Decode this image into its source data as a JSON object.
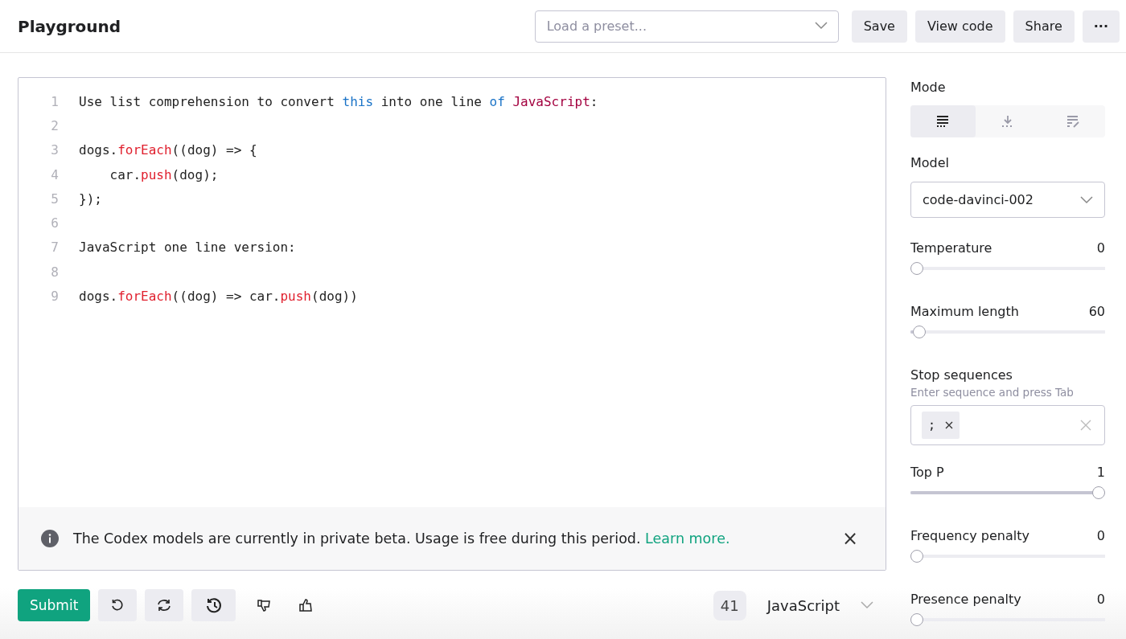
{
  "header": {
    "title": "Playground",
    "preset": {
      "placeholder": "Load a preset..."
    },
    "buttons": [
      "Save",
      "View code",
      "Share"
    ],
    "more": "···"
  },
  "editor": {
    "lines": [
      {
        "number": "1",
        "tokens": [
          {
            "text": "Use list comprehension to convert ",
            "kind": "plain"
          },
          {
            "text": "this",
            "kind": "keyword"
          },
          {
            "text": " into one line ",
            "kind": "plain"
          },
          {
            "text": "of",
            "kind": "keyword"
          },
          {
            "text": " JavaScript",
            "kind": "type"
          },
          {
            "text": ":",
            "kind": "plain"
          }
        ]
      },
      {
        "number": "2"
      },
      {
        "number": "3",
        "tokens": [
          {
            "text": "dogs.",
            "kind": "plain"
          },
          {
            "text": "forEach",
            "kind": "function"
          },
          {
            "text": "((dog) => {",
            "kind": "plain"
          }
        ]
      },
      {
        "number": "4",
        "tokens": [
          {
            "text": "    car.",
            "kind": "plain"
          },
          {
            "text": "push",
            "kind": "function"
          },
          {
            "text": "(dog);",
            "kind": "plain"
          }
        ]
      },
      {
        "number": "5",
        "tokens": [
          {
            "text": "});",
            "kind": "plain"
          }
        ]
      },
      {
        "number": "6"
      },
      {
        "number": "7",
        "tokens": [
          {
            "text": "JavaScript one line version:",
            "kind": "plain"
          }
        ]
      },
      {
        "number": "8"
      },
      {
        "number": "9",
        "tokens": [
          {
            "text": "dogs.",
            "kind": "plain"
          },
          {
            "text": "forEach",
            "kind": "function"
          },
          {
            "text": "((dog) => car.",
            "kind": "plain"
          },
          {
            "text": "push",
            "kind": "function"
          },
          {
            "text": "(dog))",
            "kind": "plain"
          }
        ]
      }
    ],
    "notice": {
      "text": "The Codex models are currently in private beta. Usage is free during this period.",
      "link": "Learn more.",
      "close": "×"
    }
  },
  "toolbar": {
    "submit": "Submit",
    "token_count": "41",
    "language": "JavaScript"
  },
  "settings": {
    "mode": {
      "label": "Mode",
      "options": [
        {
          "kind": "complete",
          "selected": true
        },
        {
          "kind": "insert",
          "selected": false
        },
        {
          "kind": "edit",
          "selected": false
        }
      ]
    },
    "model": {
      "label": "Model",
      "value": "code-davinci-002"
    },
    "sliders": [
      {
        "label": "Temperature",
        "reading": "0",
        "level": 0
      },
      {
        "label": "Maximum length",
        "reading": "60",
        "level": 0.015
      }
    ],
    "stop": {
      "label": "Stop sequences",
      "hint": "Enter sequence and press Tab",
      "chips": [
        ";"
      ]
    },
    "sliders2": [
      {
        "label": "Top P",
        "reading": "1",
        "level": 1
      },
      {
        "label": "Frequency penalty",
        "reading": "0",
        "level": 0
      },
      {
        "label": "Presence penalty",
        "reading": "0",
        "level": 0
      }
    ]
  }
}
